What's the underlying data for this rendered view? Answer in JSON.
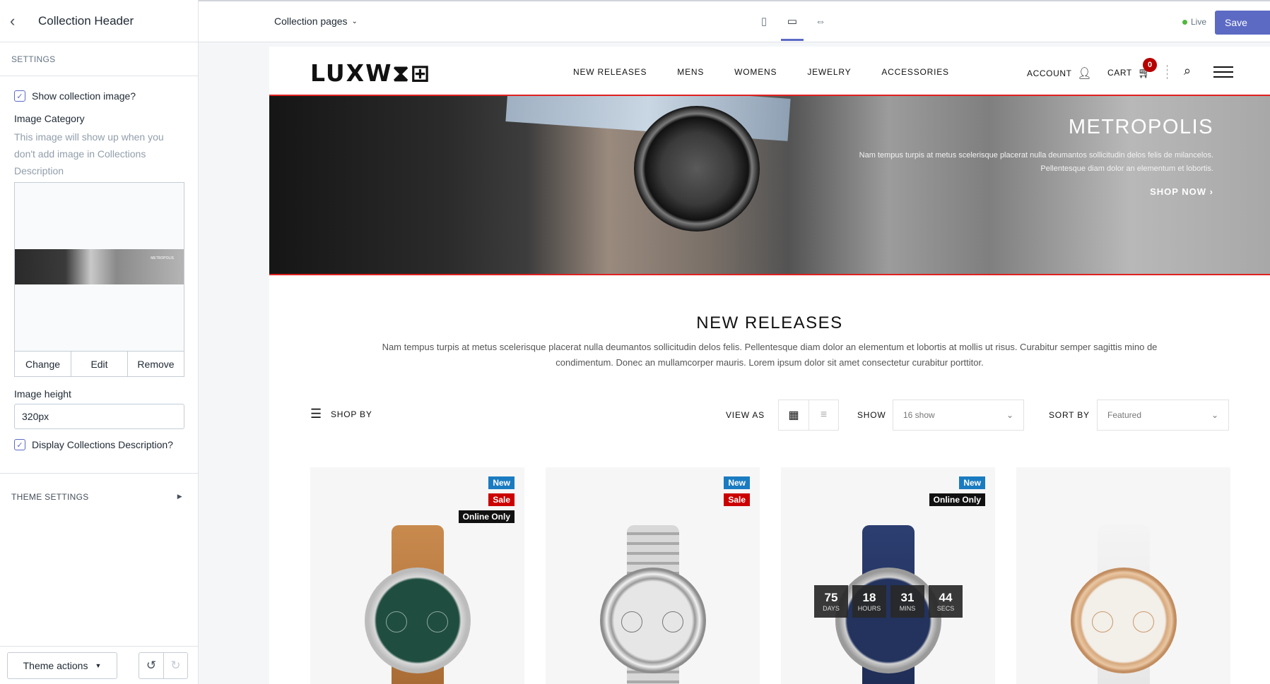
{
  "sidebar": {
    "title": "Collection Header",
    "section_label": "SETTINGS",
    "show_image_label": "Show collection image?",
    "image_category_label": "Image Category",
    "image_category_help": "This image will show up when you don't add image in Collections Description",
    "thumb_text": "METROPOLIS",
    "image_buttons": [
      "Change",
      "Edit",
      "Remove"
    ],
    "image_height_label": "Image height",
    "image_height_value": "320px",
    "display_desc_label": "Display Collections Description?",
    "theme_settings_label": "THEME SETTINGS",
    "theme_actions_label": "Theme actions"
  },
  "topbar": {
    "page_select": "Collection pages",
    "live_label": "Live",
    "save_label": "Save"
  },
  "store": {
    "logo": "LUXW⧗⊞",
    "nav": [
      "NEW RELEASES",
      "MENS",
      "WOMENS",
      "JEWELRY",
      "ACCESSORIES"
    ],
    "account_label": "ACCOUNT",
    "cart_label": "CART",
    "cart_count": "0"
  },
  "banner": {
    "title": "METROPOLIS",
    "text": "Nam tempus turpis at metus scelerisque placerat nulla deumantos sollicitudin delos felis de milancelos. Pellentesque diam dolor an elementum et lobortis.",
    "cta": "SHOP NOW ›"
  },
  "collection": {
    "title": "NEW RELEASES",
    "description": "Nam tempus turpis at metus scelerisque placerat nulla deumantos sollicitudin delos felis. Pellentesque diam dolor an elementum et lobortis at mollis ut risus. Curabitur semper sagittis mino de condimentum. Donec an mullamcorper mauris. Lorem ipsum dolor sit amet consectetur curabitur porttitor."
  },
  "toolbar": {
    "shop_by": "SHOP BY",
    "view_as": "VIEW AS",
    "show_label": "SHOW",
    "show_value": "16 show",
    "sort_label": "SORT BY",
    "sort_value": "Featured"
  },
  "products": [
    {
      "badges": [
        "New",
        "Sale",
        "Online Only"
      ]
    },
    {
      "badges": [
        "New",
        "Sale"
      ]
    },
    {
      "badges": [
        "New",
        "Online Only"
      ],
      "countdown": [
        {
          "n": "75",
          "l": "DAYS"
        },
        {
          "n": "18",
          "l": "HOURS"
        },
        {
          "n": "31",
          "l": "MINS"
        },
        {
          "n": "44",
          "l": "SECS"
        }
      ]
    },
    {
      "badges": []
    }
  ],
  "colors": {
    "accent": "#5c6ac4",
    "sale": "#cc0000",
    "new": "#1a7bc1",
    "highlight": "#e02020"
  }
}
